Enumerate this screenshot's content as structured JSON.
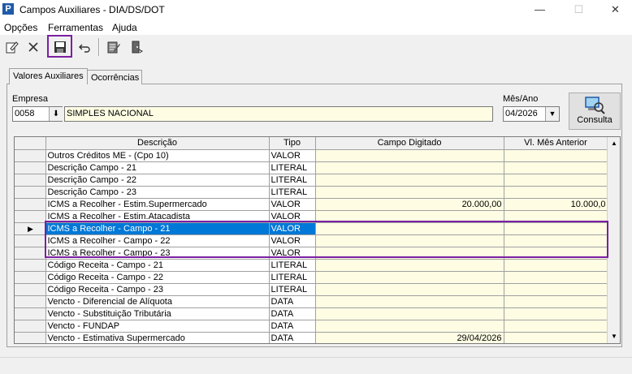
{
  "window": {
    "app_icon": "P",
    "title": "Campos Auxiliares - DIA/DS/DOT",
    "minimize": "—",
    "maximize": "☐",
    "close": "✕"
  },
  "menu": [
    "Opções",
    "Ferramentas",
    "Ajuda"
  ],
  "toolbar": {
    "icons": [
      "edit-icon",
      "delete-icon",
      "save-icon",
      "undo-icon",
      "report-icon",
      "exit-icon"
    ]
  },
  "tabs": [
    "Valores Auxiliares",
    "Ocorrências"
  ],
  "empresa": {
    "label": "Empresa",
    "code": "0058",
    "name": "SIMPLES NACIONAL"
  },
  "mes_ano": {
    "label": "Mês/Ano",
    "value": "04/2026"
  },
  "consulta_label": "Consulta",
  "grid": {
    "columns": [
      "Descrição",
      "Tipo",
      "Campo Digitado",
      "Vl. Mês Anterior"
    ],
    "rows": [
      {
        "desc": "Outros Créditos ME - (Cpo 10)",
        "tipo": "VALOR",
        "digitado": "",
        "anterior": ""
      },
      {
        "desc": "Descrição Campo - 21",
        "tipo": "LITERAL",
        "digitado": "",
        "anterior": ""
      },
      {
        "desc": "Descrição Campo - 22",
        "tipo": "LITERAL",
        "digitado": "",
        "anterior": ""
      },
      {
        "desc": "Descrição Campo - 23",
        "tipo": "LITERAL",
        "digitado": "",
        "anterior": ""
      },
      {
        "desc": "ICMS a Recolher - Estim.Supermercado",
        "tipo": "VALOR",
        "digitado": "20.000,00",
        "anterior": "10.000,0"
      },
      {
        "desc": "ICMS a Recolher - Estim.Atacadista",
        "tipo": "VALOR",
        "digitado": "",
        "anterior": ""
      },
      {
        "desc": "ICMS a Recolher - Campo - 21",
        "tipo": "VALOR",
        "digitado": "",
        "anterior": "",
        "selected": true
      },
      {
        "desc": "ICMS a Recolher - Campo - 22",
        "tipo": "VALOR",
        "digitado": "",
        "anterior": ""
      },
      {
        "desc": "ICMS a Recolher - Campo - 23",
        "tipo": "VALOR",
        "digitado": "",
        "anterior": ""
      },
      {
        "desc": "Código Receita  - Campo - 21",
        "tipo": "LITERAL",
        "digitado": "",
        "anterior": ""
      },
      {
        "desc": "Código Receita  - Campo - 22",
        "tipo": "LITERAL",
        "digitado": "",
        "anterior": ""
      },
      {
        "desc": "Código Receita  - Campo - 23",
        "tipo": "LITERAL",
        "digitado": "",
        "anterior": ""
      },
      {
        "desc": "Vencto - Diferencial de Alíquota",
        "tipo": "DATA",
        "digitado": "",
        "anterior": ""
      },
      {
        "desc": "Vencto - Substituição Tributária",
        "tipo": "DATA",
        "digitado": "",
        "anterior": ""
      },
      {
        "desc": "Vencto - FUNDAP",
        "tipo": "DATA",
        "digitado": "",
        "anterior": ""
      },
      {
        "desc": "Vencto - Estimativa Supermercado",
        "tipo": "DATA",
        "digitado": "29/04/2026",
        "anterior": ""
      }
    ]
  },
  "colors": {
    "selection": "#0078d7",
    "highlight_box": "#7b1fa2",
    "field_yellow": "#fefde4"
  }
}
